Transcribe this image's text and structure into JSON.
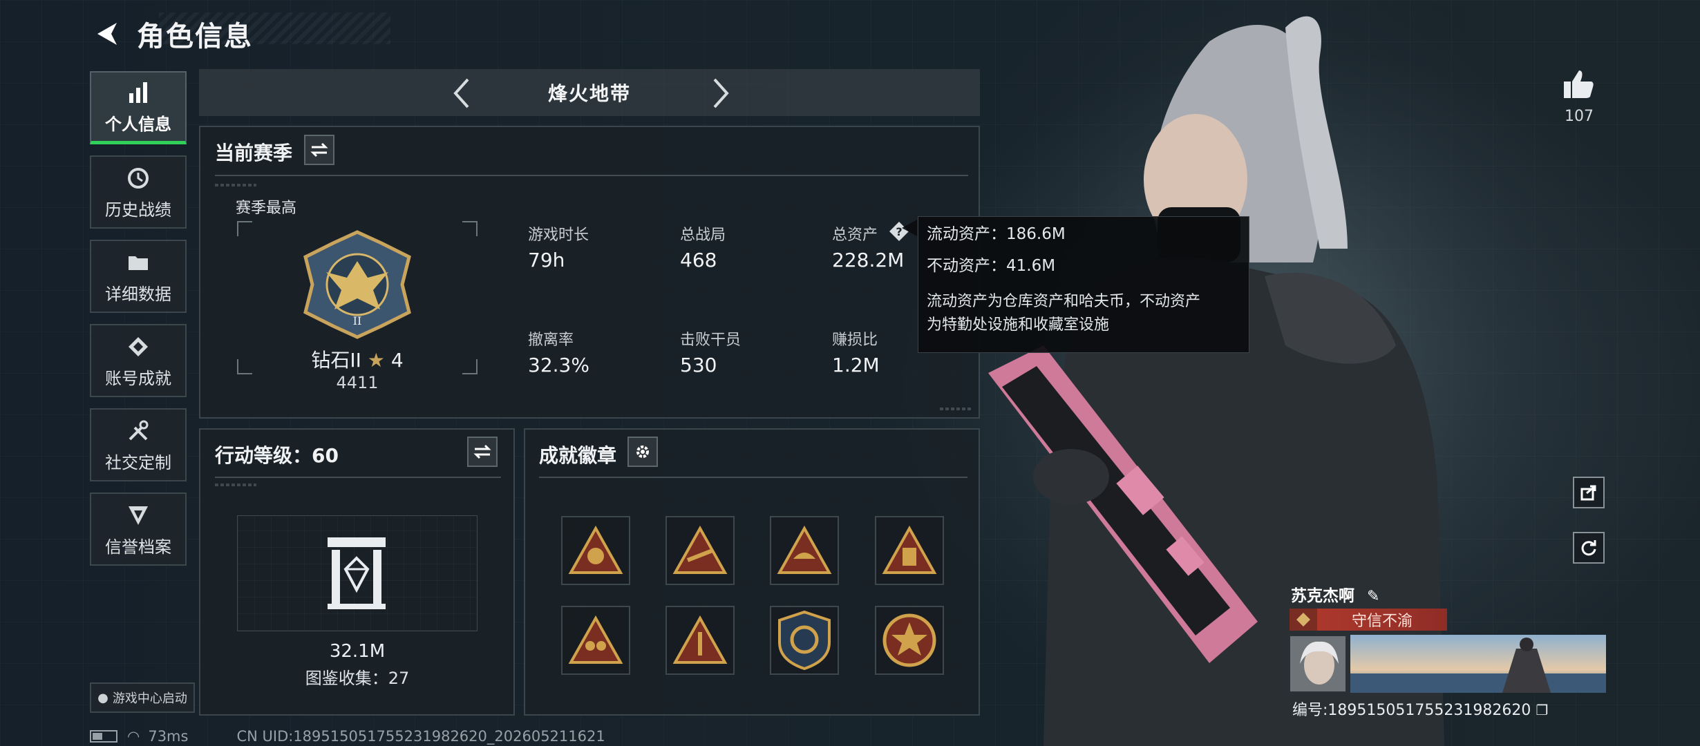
{
  "header": {
    "title": "角色信息"
  },
  "sidebar": {
    "items": [
      {
        "label": "个人信息",
        "icon": "bar-chart-icon",
        "active": true
      },
      {
        "label": "历史战绩",
        "icon": "history-icon"
      },
      {
        "label": "详细数据",
        "icon": "folder-icon"
      },
      {
        "label": "账号成就",
        "icon": "achievement-icon"
      },
      {
        "label": "社交定制",
        "icon": "tools-icon"
      },
      {
        "label": "信誉档案",
        "icon": "credit-icon"
      }
    ],
    "game_center": "游戏中心启动"
  },
  "mode_selector": {
    "title": "烽火地带"
  },
  "season": {
    "title": "当前赛季",
    "subtitle": "赛季最高",
    "rank_name": "钻石II",
    "rank_stars": "4",
    "rank_score": "4411",
    "stats": [
      {
        "label": "游戏时长",
        "value": "79h"
      },
      {
        "label": "总战局",
        "value": "468"
      },
      {
        "label": "总资产",
        "value": "228.2M",
        "has_help": true
      },
      {
        "label": "撤离率",
        "value": "32.3%"
      },
      {
        "label": "击败干员",
        "value": "530"
      },
      {
        "label": "赚损比",
        "value": "1.2M"
      }
    ]
  },
  "tooltip": {
    "liquid": "流动资产：186.6M",
    "fixed": "不动资产：41.6M",
    "desc_line1": "流动资产为仓库资产和哈夫币，不动资产",
    "desc_line2": "为特勤处设施和收藏室设施"
  },
  "action_level": {
    "title": "行动等级：60",
    "collection_value": "32.1M",
    "collection_label": "图鉴收集：27"
  },
  "badges": {
    "title": "成就徽章",
    "items": [
      "triangle-badge-1",
      "triangle-badge-2",
      "triangle-badge-3",
      "triangle-badge-4",
      "triangle-badge-5",
      "triangle-badge-6",
      "shield-badge",
      "star-badge"
    ]
  },
  "profile": {
    "like_count": "107",
    "name": "苏克杰啊",
    "title_badge": "守信不渝",
    "uid": "编号:18951505175523198262​0"
  },
  "status": {
    "ping": "73ms",
    "uid_line": "CN UID:18951505175523198262​0_202605211621"
  },
  "colors": {
    "accent_green": "#30d158",
    "badge_red": "#b33a2e",
    "gold": "#c9a45c"
  }
}
